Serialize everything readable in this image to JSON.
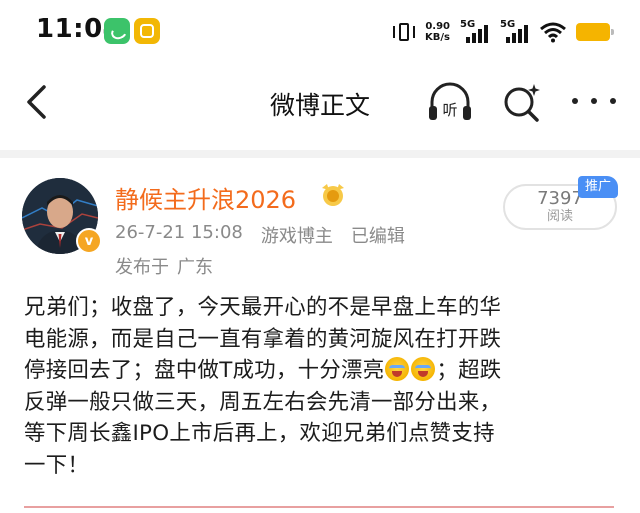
{
  "status_bar": {
    "time": "11:04",
    "net_speed_value": "0.90",
    "net_speed_unit": "KB/s",
    "signal1_label": "5G",
    "signal2_label": "5G",
    "battery_color": "#f5b400"
  },
  "nav": {
    "title": "微博正文",
    "listen_label": "听"
  },
  "post": {
    "username": "静候主升浪2026",
    "date": "26-7-21 15:08",
    "role": "游戏博主",
    "edited": "已编辑",
    "location_prefix": "发布于",
    "location": "广东",
    "reads_count": "7397",
    "reads_label": "阅读",
    "promo_tag": "推广",
    "verified_badge": "v",
    "content_lines": [
      "兄弟们；收盘了，今天最开心的不是早盘上车的华",
      "电能源，而是自己一直有拿着的黄河旋风在打开跌",
      "停接回去了；盘中做T成功，十分漂亮",
      "；超跌",
      "反弹一般只做三天，周五左右会先清一部分出来，",
      "等下周长鑫IPO上市后再上，欢迎兄弟们点赞支持",
      "一下！"
    ]
  },
  "colors": {
    "username": "#f36b1c",
    "promo_tag": "#4a8ff5",
    "meta_text": "#8a8a8a"
  },
  "icons": [
    "back-arrow-icon",
    "headphones-icon",
    "ai-search-icon",
    "more-dots-icon",
    "vibrate-icon",
    "wifi-icon",
    "battery-icon"
  ]
}
